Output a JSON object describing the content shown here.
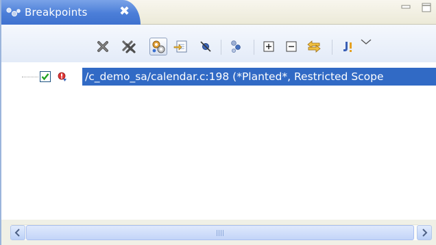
{
  "view": {
    "tab_title": "Breakpoints",
    "tab_close_glyph": "✖",
    "tab_icon": "breakpoints-view-icon"
  },
  "window_controls": {
    "minimize_icon": "minimize-icon",
    "maximize_icon": "maximize-icon"
  },
  "toolbar": {
    "items": [
      {
        "name": "remove-selected-breakpoints",
        "icon": "remove-x-icon"
      },
      {
        "name": "remove-all-breakpoints",
        "icon": "remove-all-icon"
      },
      {
        "name": "show-breakpoints-supported-by-target",
        "icon": "gears-icon",
        "pressed": true
      },
      {
        "name": "go-to-file",
        "icon": "goto-file-icon"
      },
      {
        "name": "skip-all-breakpoints",
        "icon": "skip-breakpoints-icon"
      },
      {
        "name": "link-with-debug-view",
        "icon": "link-icon"
      },
      {
        "name": "expand-all",
        "icon": "expand-all-icon"
      },
      {
        "name": "collapse-all",
        "icon": "collapse-all-icon"
      },
      {
        "name": "link-with-view",
        "icon": "sync-arrows-icon"
      },
      {
        "name": "add-java-exception-breakpoint",
        "icon": "exception-breakpoint-icon"
      },
      {
        "name": "view-menu",
        "icon": "view-menu-chevron-icon"
      }
    ]
  },
  "breakpoints": [
    {
      "checked": true,
      "icon": "breakpoint-restricted-icon",
      "label": "/c_demo_sa/calendar.c:198 (*Planted*, Restricted Scope"
    }
  ],
  "scrollbar": {
    "left_icon": "scroll-left-arrow-icon",
    "right_icon": "scroll-right-arrow-icon"
  },
  "colors": {
    "tab_active": "#4b7ed8",
    "selection": "#316ac5",
    "toolbar_bg": "#e3ebf8"
  }
}
